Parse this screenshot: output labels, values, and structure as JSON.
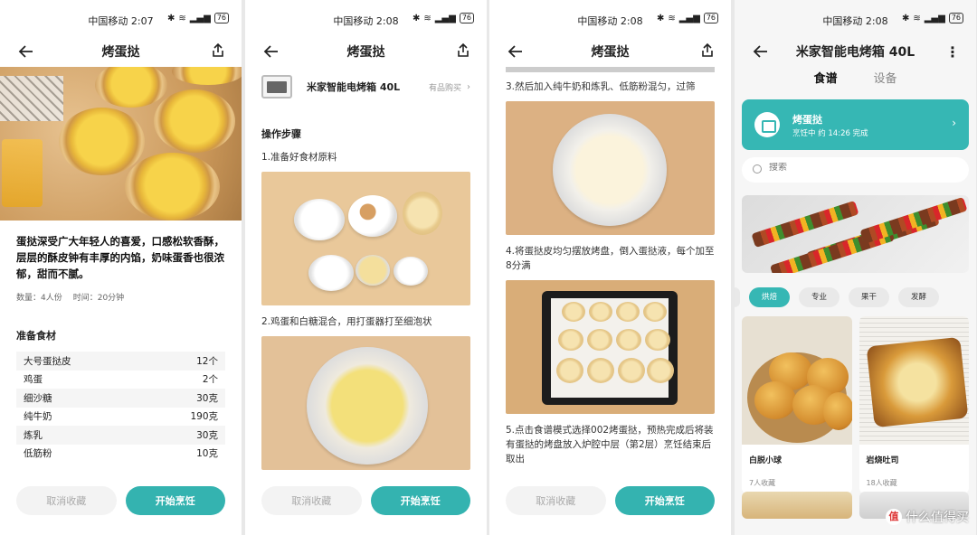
{
  "status": {
    "screen1": {
      "carrier_time": "中国移动 2:07",
      "battery": "76"
    },
    "screen2": {
      "carrier_time": "中国移动 2:08",
      "battery": "76"
    },
    "screen3": {
      "carrier_time": "中国移动 2:08",
      "battery": "76"
    },
    "screen4": {
      "carrier_time": "中国移动 2:08",
      "battery": "76"
    }
  },
  "recipe": {
    "title": "烤蛋挞",
    "intro": "蛋挞深受广大年轻人的喜爱，口感松软香酥，层层的酥皮钟有丰厚的内馅，奶味蛋香也很浓郁，甜而不腻。",
    "servings": "数量：4人份",
    "time": "时间：20分钟",
    "ingredients_title": "准备食材",
    "ingredients": [
      {
        "name": "大号蛋挞皮",
        "amount": "12个"
      },
      {
        "name": "鸡蛋",
        "amount": "2个"
      },
      {
        "name": "细沙糖",
        "amount": "30克"
      },
      {
        "name": "纯牛奶",
        "amount": "190克"
      },
      {
        "name": "炼乳",
        "amount": "30克"
      },
      {
        "name": "低筋粉",
        "amount": "10克"
      }
    ],
    "product_name": "米家智能电烤箱 40L",
    "product_buy": "有品购买",
    "steps_title": "操作步骤",
    "steps": [
      "1.准备好食材原料",
      "2.鸡蛋和白糖混合，用打蛋器打至细泡状",
      "3.然后加入纯牛奶和炼乳、低筋粉混匀，过筛",
      "4.将蛋挞皮均匀摆放烤盘，倒入蛋挞液，每个加至8分满",
      "5.点击食谱模式选择002烤蛋挞，预热完成后将装有蛋挞的烤盘放入炉腔中层（第2层）烹饪结束后取出"
    ]
  },
  "buttons": {
    "cancel_fav": "取消收藏",
    "start_cook": "开始烹饪"
  },
  "app": {
    "title": "米家智能电烤箱 40L",
    "tabs": [
      "食谱",
      "设备"
    ],
    "cooking": {
      "title": "烤蛋挞",
      "status": "烹饪中 约 14:26 完成"
    },
    "search_placeholder": "搜索",
    "categories": [
      "烘焙",
      "专业",
      "果干",
      "发酵"
    ],
    "cards": [
      {
        "name": "白脱小球",
        "favs": "7人收藏"
      },
      {
        "name": "岩烧吐司",
        "favs": "18人收藏"
      }
    ]
  },
  "watermark": "什么值得买",
  "colors": {
    "accent": "#34b3b0"
  }
}
